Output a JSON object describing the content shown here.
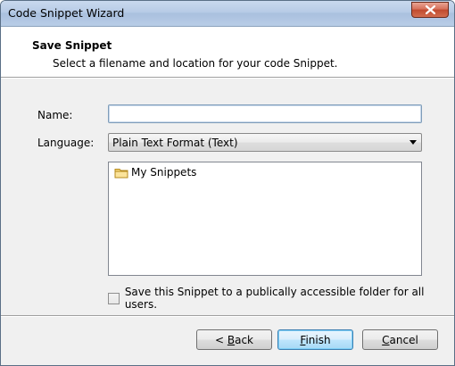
{
  "window": {
    "title": "Code Snippet Wizard"
  },
  "header": {
    "title": "Save Snippet",
    "subtitle": "Select a filename and location for your code Snippet."
  },
  "form": {
    "name_label": "Name:",
    "name_value": "",
    "language_label": "Language:",
    "language_value": "Plain Text Format (Text)",
    "tree_items": [
      "My Snippets"
    ],
    "public_checkbox_label": "Save this Snippet to a publically accessible folder for all users.",
    "public_checked": false
  },
  "buttons": {
    "back_prefix": "< ",
    "back_mnemonic": "B",
    "back_rest": "ack",
    "finish_mnemonic": "F",
    "finish_rest": "inish",
    "cancel_mnemonic": "C",
    "cancel_rest": "ancel"
  },
  "icons": {
    "close": "close-icon",
    "folder": "folder-icon",
    "dropdown": "chevron-down-icon"
  }
}
